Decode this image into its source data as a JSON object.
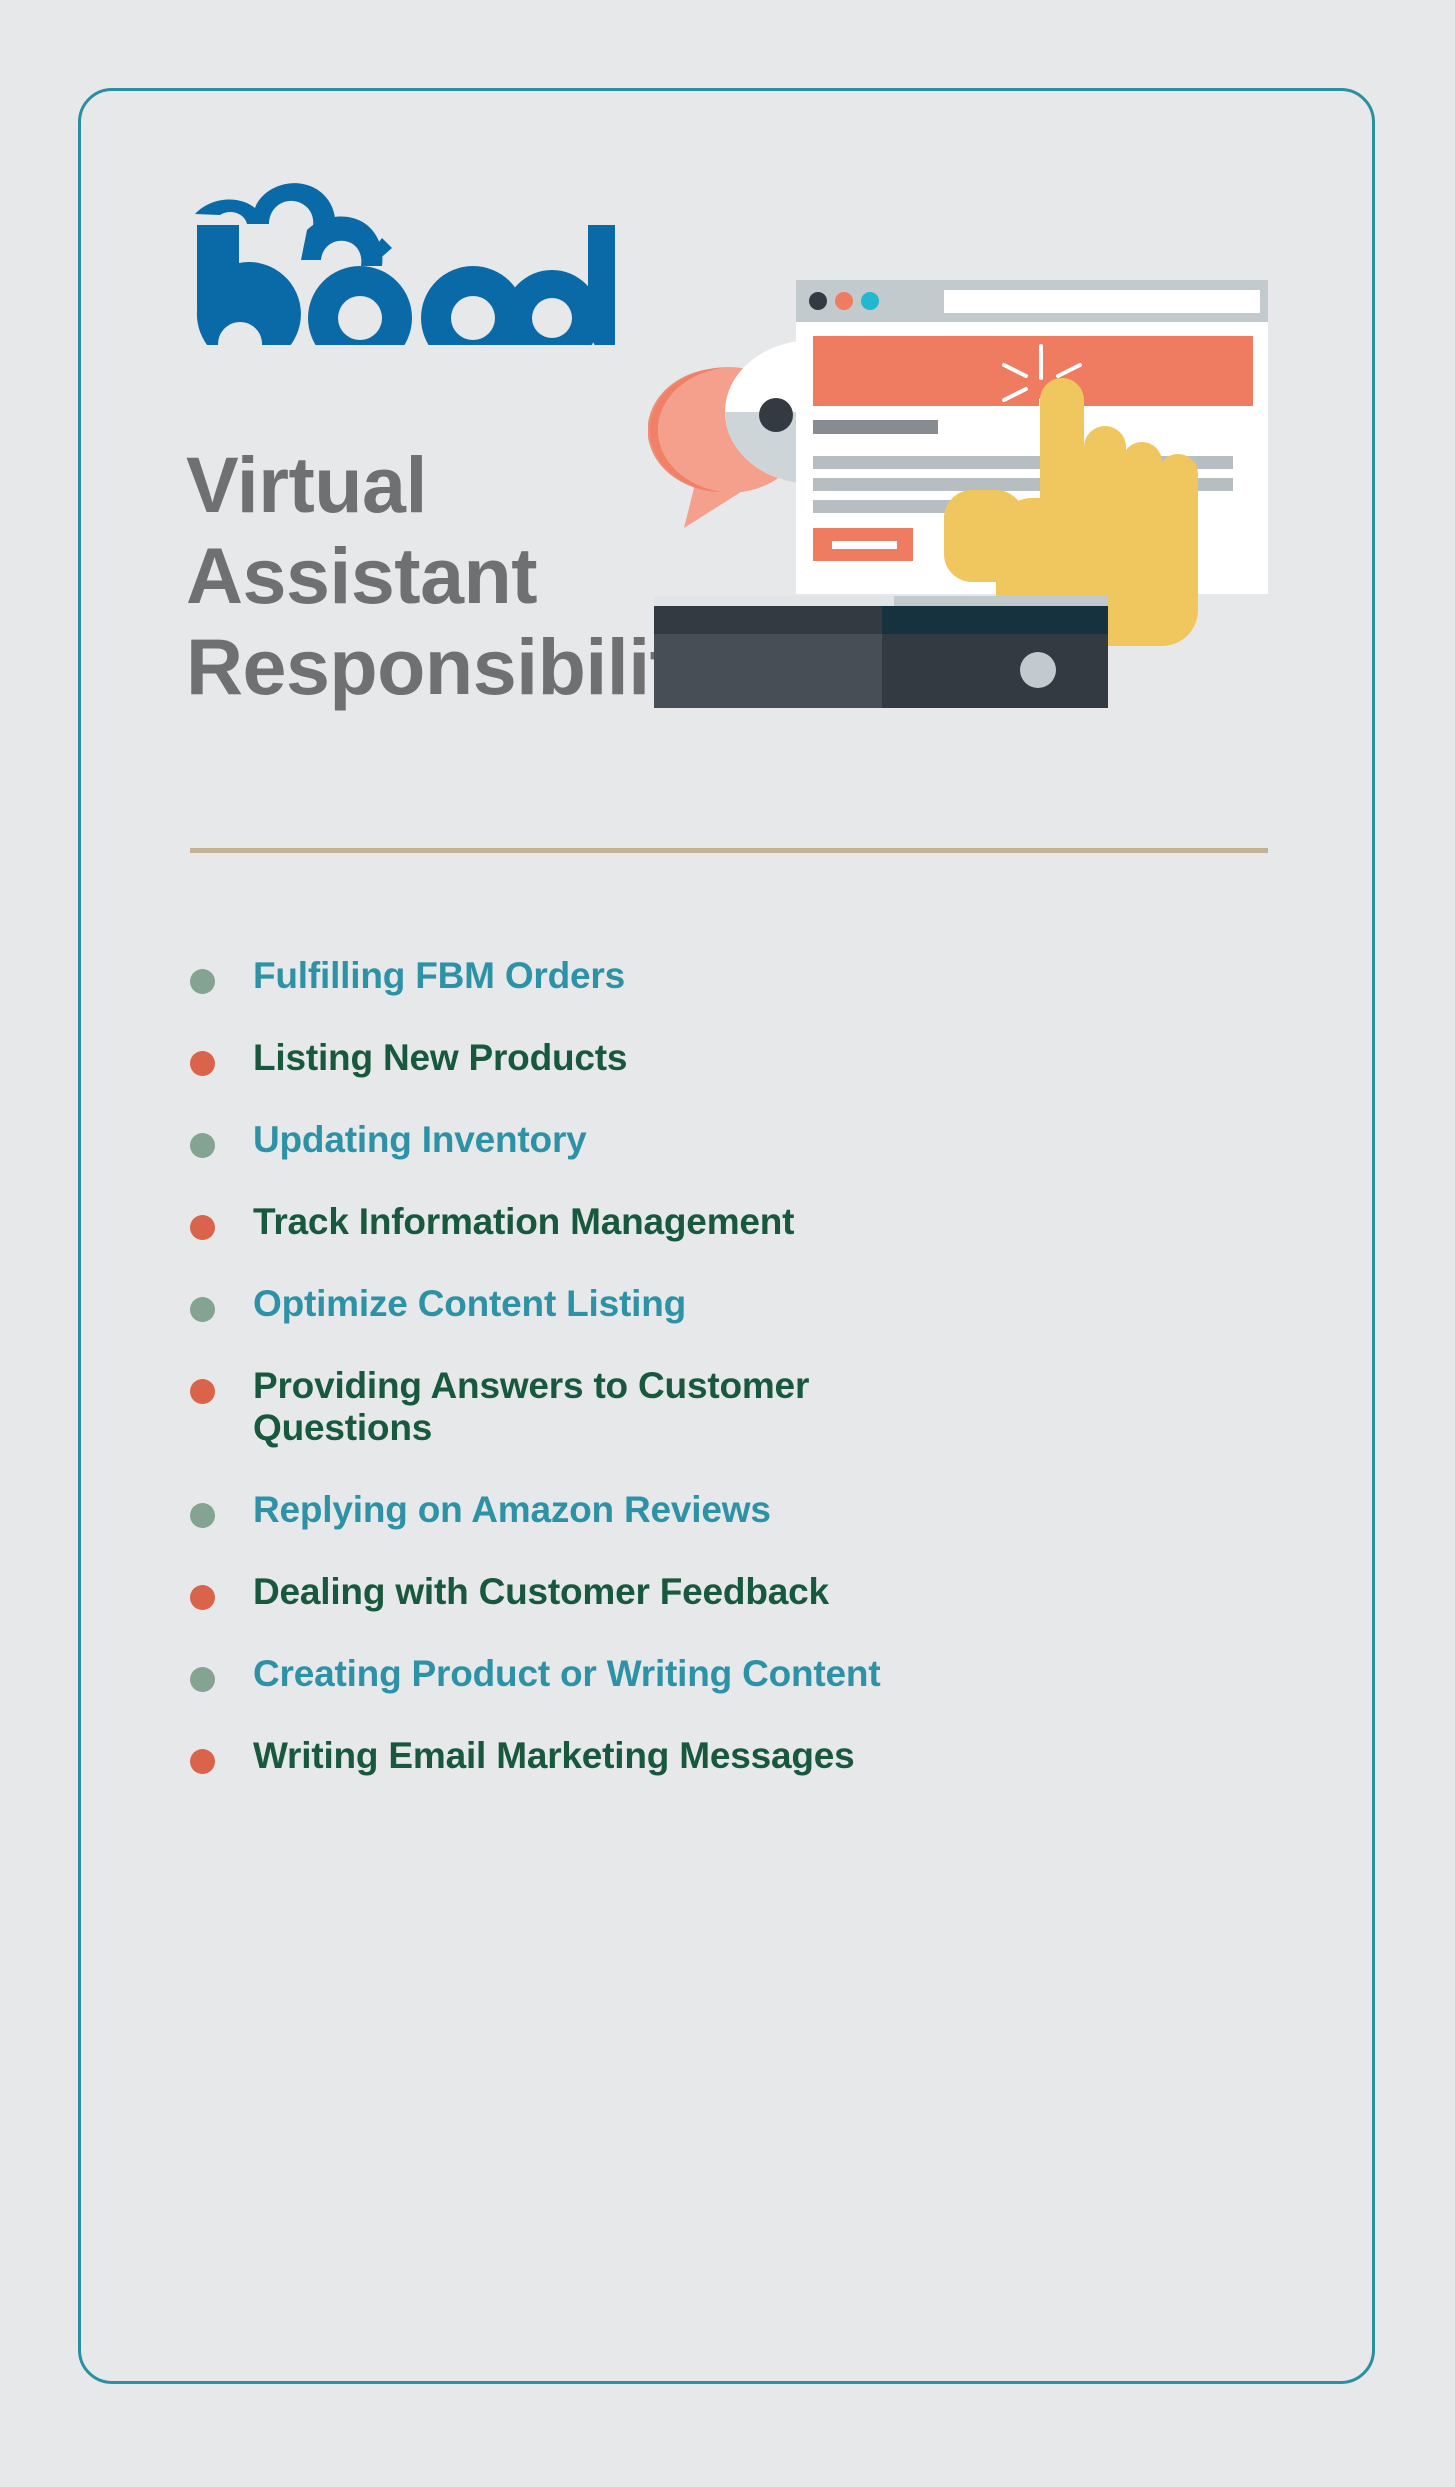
{
  "brand": {
    "logo_text": "bqool",
    "logo_color": "#0a6aa8"
  },
  "heading": {
    "line1": "Virtual",
    "line2": "Assistant",
    "line3": "Responsibilities",
    "color": "#6e7072"
  },
  "card": {
    "border_color": "#2a8fa3",
    "background": "#e7e8ea"
  },
  "divider": {
    "color": "#c3b392"
  },
  "palette": {
    "teal_text": "#2e92a6",
    "green_text": "#18583e",
    "sage_bullet": "#85a391",
    "terracotta_bullet": "#d9634b",
    "salmon": "#ef7b61",
    "salmon_light": "#f4a08c",
    "hand_yellow": "#efc75e",
    "dark_slate": "#343a41",
    "light_gray": "#c3cacd",
    "browser_dot_teal": "#22b8cf"
  },
  "illustration": {
    "name": "click-on-webpage-with-chat-bubbles",
    "browser_dots": [
      "dark",
      "salmon",
      "teal"
    ],
    "chat_bubble_dots": 3
  },
  "list": {
    "items": [
      {
        "label": "Fulfilling FBM Orders",
        "style": "odd"
      },
      {
        "label": "Listing New Products",
        "style": "even"
      },
      {
        "label": "Updating Inventory",
        "style": "odd"
      },
      {
        "label": "Track Information Management",
        "style": "even"
      },
      {
        "label": "Optimize Content Listing",
        "style": "odd"
      },
      {
        "label": "Providing Answers to Customer Questions",
        "style": "even"
      },
      {
        "label": "Replying on Amazon Reviews",
        "style": "odd"
      },
      {
        "label": "Dealing with Customer Feedback",
        "style": "even"
      },
      {
        "label": "Creating Product or Writing Content",
        "style": "odd"
      },
      {
        "label": "Writing Email Marketing Messages",
        "style": "even"
      }
    ]
  }
}
